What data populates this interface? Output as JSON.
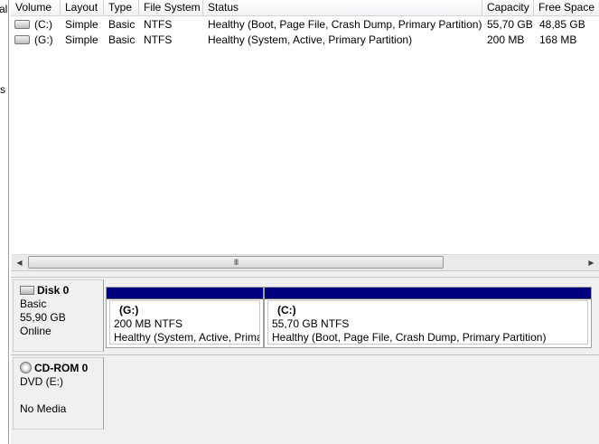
{
  "left_pane": {
    "frag_top": "al",
    "frag_mid": "s"
  },
  "volume_list": {
    "columns": [
      "Volume",
      "Layout",
      "Type",
      "File System",
      "Status",
      "Capacity",
      "Free Space"
    ],
    "rows": [
      {
        "volume": "(C:)",
        "layout": "Simple",
        "type": "Basic",
        "fs": "NTFS",
        "status": "Healthy (Boot, Page File, Crash Dump, Primary Partition)",
        "capacity": "55,70 GB",
        "free": "48,85 GB"
      },
      {
        "volume": "(G:)",
        "layout": "Simple",
        "type": "Basic",
        "fs": "NTFS",
        "status": "Healthy (System, Active, Primary Partition)",
        "capacity": "200 MB",
        "free": "168 MB"
      }
    ]
  },
  "scrollbar": {
    "grip": "III",
    "left_arrow_icon": "left-arrow-icon",
    "right_arrow_icon": "right-arrow-icon"
  },
  "disks": [
    {
      "name": "Disk 0",
      "type": "Basic",
      "size": "55,90 GB",
      "status": "Online",
      "icon": "hard-disk-icon",
      "partitions": [
        {
          "name": "(G:)",
          "size_fs": "200 MB NTFS",
          "status": "Healthy (System, Active, Primary Partition)"
        },
        {
          "name": "(C:)",
          "size_fs": "55,70 GB NTFS",
          "status": "Healthy (Boot, Page File, Crash Dump, Primary Partition)"
        }
      ]
    },
    {
      "name": "CD-ROM 0",
      "type": "DVD (E:)",
      "status": "No Media",
      "icon": "cd-rom-icon"
    }
  ],
  "colors": {
    "primary_partition_bar": "#00007f",
    "pane_bg": "#f0f0f0"
  }
}
